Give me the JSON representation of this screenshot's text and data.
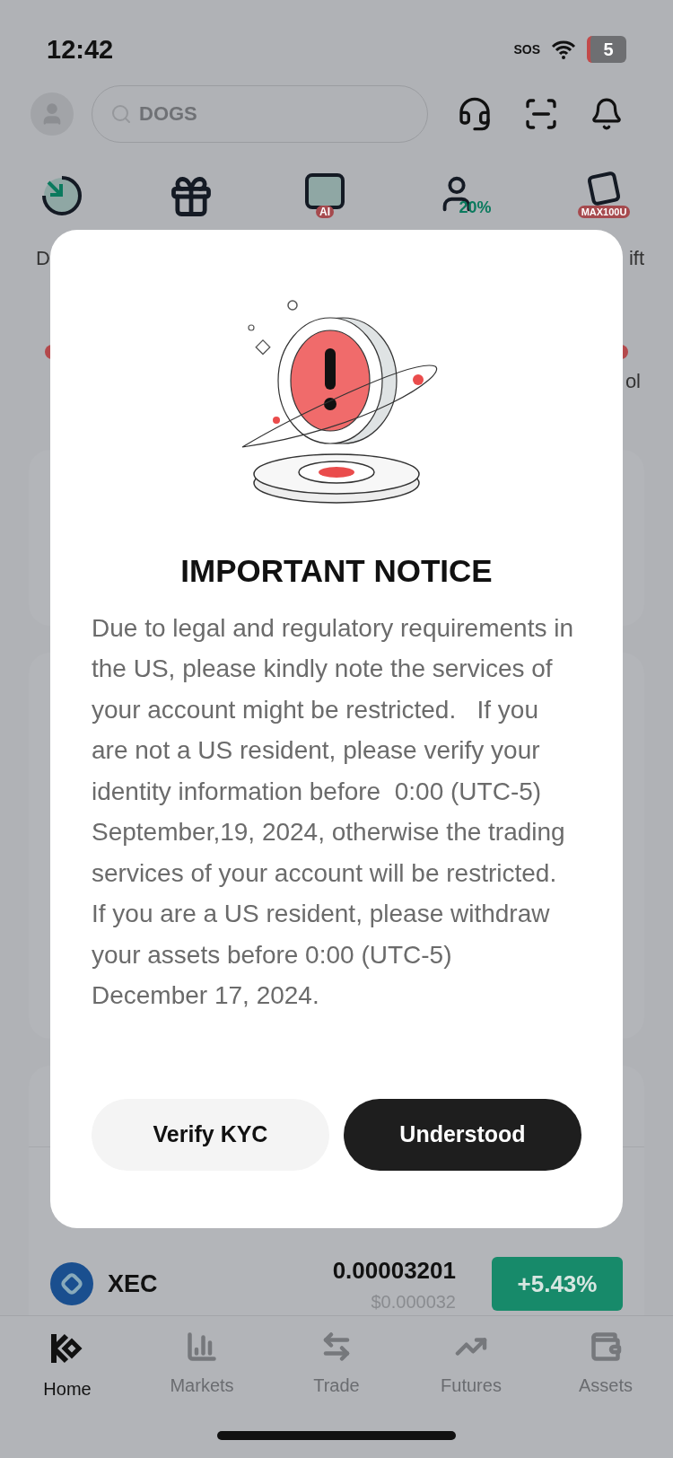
{
  "status_bar": {
    "time": "12:42",
    "sos": "SOS",
    "battery": "5"
  },
  "search": {
    "placeholder": "DOGS"
  },
  "shortcuts": [
    {
      "kind": "deposit",
      "label": "D"
    },
    {
      "kind": "gift"
    },
    {
      "kind": "bot",
      "badge": "AI"
    },
    {
      "kind": "referral",
      "badge": "20%"
    },
    {
      "kind": "cup",
      "badge": "MAX100U",
      "label": "ift"
    }
  ],
  "second_row": {
    "label": "ol"
  },
  "market_row": {
    "symbol": "XEC",
    "price": "0.00003201",
    "usd": "$0.000032",
    "change": "+5.43%"
  },
  "modal": {
    "title": "IMPORTANT NOTICE",
    "body": "Due to legal and regulatory requirements in the US, please kindly note the services of your account might be restricted.   If you are not a US resident, please verify your identity information before  0:00 (UTC-5) September,19, 2024, otherwise the trading services of your account will be restricted.  If you are a US resident, please withdraw your assets before 0:00 (UTC-5)  December 17, 2024.",
    "buttons": [
      {
        "label": "Verify KYC",
        "kind": "secondary"
      },
      {
        "label": "Understood",
        "kind": "primary"
      }
    ]
  },
  "tabs": [
    {
      "label": "Home",
      "selected": true
    },
    {
      "label": "Markets",
      "selected": false
    },
    {
      "label": "Trade",
      "selected": false
    },
    {
      "label": "Futures",
      "selected": false
    },
    {
      "label": "Assets",
      "selected": false
    }
  ]
}
